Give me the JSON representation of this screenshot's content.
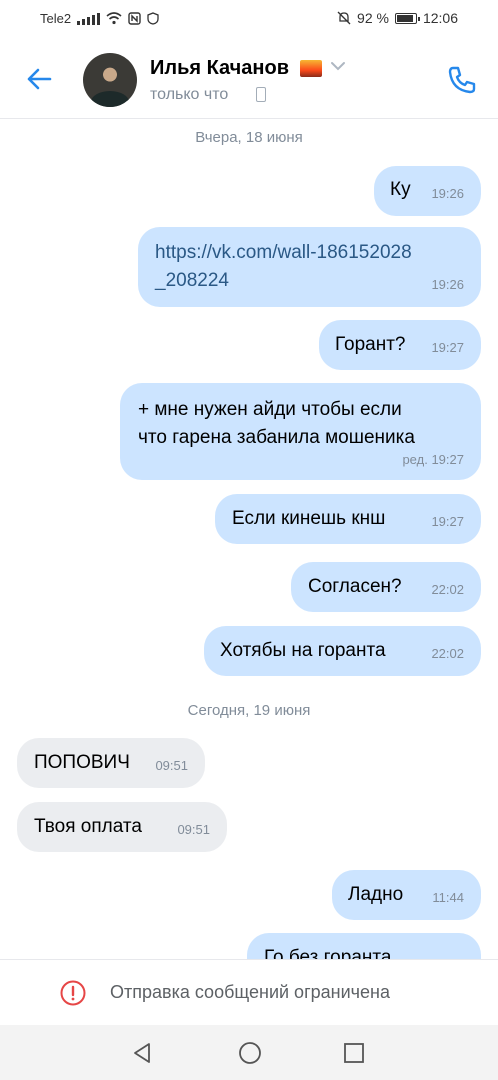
{
  "status_bar": {
    "carrier": "Tele2",
    "battery_percent": "92 %",
    "battery_level": 0.92,
    "time": "12:06"
  },
  "header": {
    "contact_name": "Илья Качанов",
    "status": "только что",
    "back_icon": "arrow-left-icon",
    "call_icon": "phone-icon",
    "accent_color": "#2688eb"
  },
  "chat": {
    "date_yesterday": "Вчера, 18 июня",
    "date_today": "Сегодня, 19 июня",
    "messages": [
      {
        "dir": "out",
        "text": "Ку",
        "time": "19:26"
      },
      {
        "dir": "out",
        "text": "https://vk.com/wall-186152028_208224",
        "line1": "https://vk.com/wall-186152028",
        "line2": "_208224",
        "time": "19:26"
      },
      {
        "dir": "out",
        "text": "Горант?",
        "time": "19:27"
      },
      {
        "dir": "out",
        "text": "+ мне нужен айди чтобы если что гарена забанила мошеника",
        "line1": "+ мне нужен айди чтобы если",
        "line2": "что гарена забанила мошеника",
        "edited": "ред.",
        "time": "19:27"
      },
      {
        "dir": "out",
        "text": "Если кинешь кнш",
        "time": "19:27"
      },
      {
        "dir": "out",
        "text": "Согласен?",
        "time": "22:02"
      },
      {
        "dir": "out",
        "text": "Хотябы на горанта",
        "time": "22:02"
      },
      {
        "dir": "in",
        "text": "ПОПОВИЧ",
        "time": "09:51"
      },
      {
        "dir": "in",
        "text": "Твоя оплата",
        "time": "09:51"
      },
      {
        "dir": "out",
        "text": "Ладно",
        "time": "11:44"
      },
      {
        "dir": "out",
        "text": "Го без горанта",
        "time": ""
      }
    ],
    "outgoing_color": "#cce4ff",
    "incoming_color": "#ebedf0"
  },
  "restriction": {
    "icon": "alert-circle-icon",
    "text": "Отправка сообщений ограничена",
    "icon_color": "#e64646"
  },
  "navbar": {
    "back": "nav-back-icon",
    "home": "nav-home-icon",
    "recent": "nav-recent-icon"
  }
}
